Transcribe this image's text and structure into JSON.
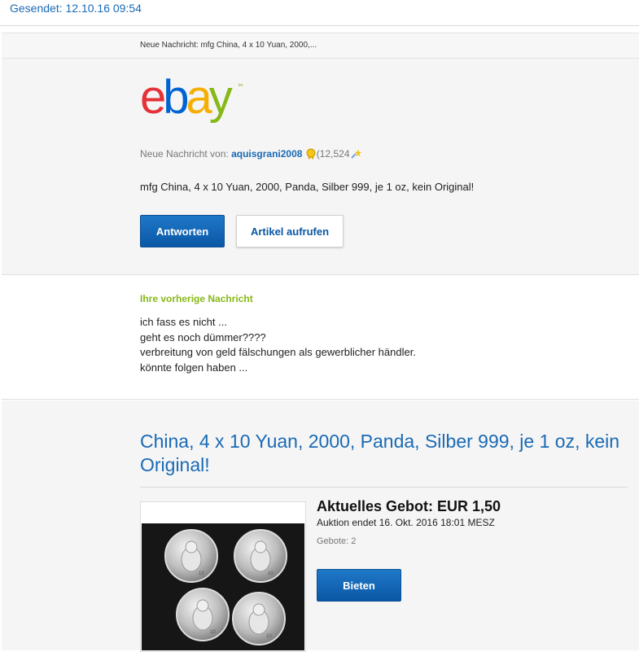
{
  "sent": "Gesendet: 12.10.16 09:54",
  "header": {
    "subject": "Neue Nachricht: mfg China, 4 x 10 Yuan, 2000,..."
  },
  "logo": {
    "e": "e",
    "b": "b",
    "a": "a",
    "y": "y",
    "tm": "tm"
  },
  "message": {
    "from_label": "Neue Nachricht von:",
    "user": "aquisgrani2008",
    "feedback_open": "(",
    "feedback": "12,524",
    "text": "mfg China, 4 x 10 Yuan, 2000, Panda, Silber 999, je 1 oz, kein Original!",
    "reply_label": "Antworten",
    "view_item_label": "Artikel aufrufen"
  },
  "previous": {
    "title": "Ihre vorherige Nachricht",
    "lines": [
      "ich fass es nicht ...",
      "geht es noch dümmer????",
      "verbreitung von geld fälschungen als gewerblicher händler.",
      "könnte folgen haben ..."
    ]
  },
  "item": {
    "title": "China, 4 x 10 Yuan, 2000, Panda, Silber 999, je 1 oz, kein Original!",
    "current_bid": "Aktuelles Gebot: EUR 1,50",
    "auction_end": "Auktion endet 16. Okt. 2016 18:01 MESZ",
    "bids": "Gebote: 2",
    "bid_button": "Bieten",
    "coins": [
      {
        "value": "10"
      },
      {
        "value": "10"
      },
      {
        "value": "10"
      },
      {
        "value": "10"
      }
    ]
  },
  "colors": {
    "link": "#1a6ab5",
    "green": "#86b817",
    "button": "#0a57a5"
  },
  "icons": [
    "star-icon",
    "shooting-star-icon"
  ]
}
